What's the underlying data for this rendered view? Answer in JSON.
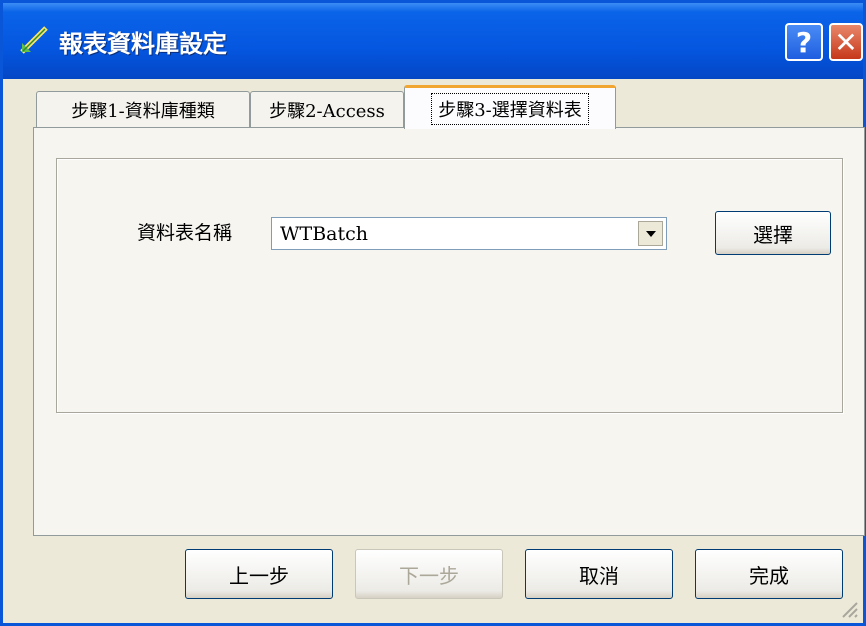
{
  "window": {
    "title": "報表資料庫設定",
    "help_label": "?",
    "close_label": "✕"
  },
  "tabs": [
    {
      "label": "步驟1-資料庫種類"
    },
    {
      "label": "步驟2-Access"
    },
    {
      "label": "步驟3-選擇資料表"
    }
  ],
  "panel": {
    "table_name_label": "資料表名稱",
    "table_name_value": "WTBatch",
    "select_button": "選擇"
  },
  "footer": {
    "prev_button": "上一步",
    "next_button": "下一步",
    "cancel_button": "取消",
    "finish_button": "完成"
  }
}
